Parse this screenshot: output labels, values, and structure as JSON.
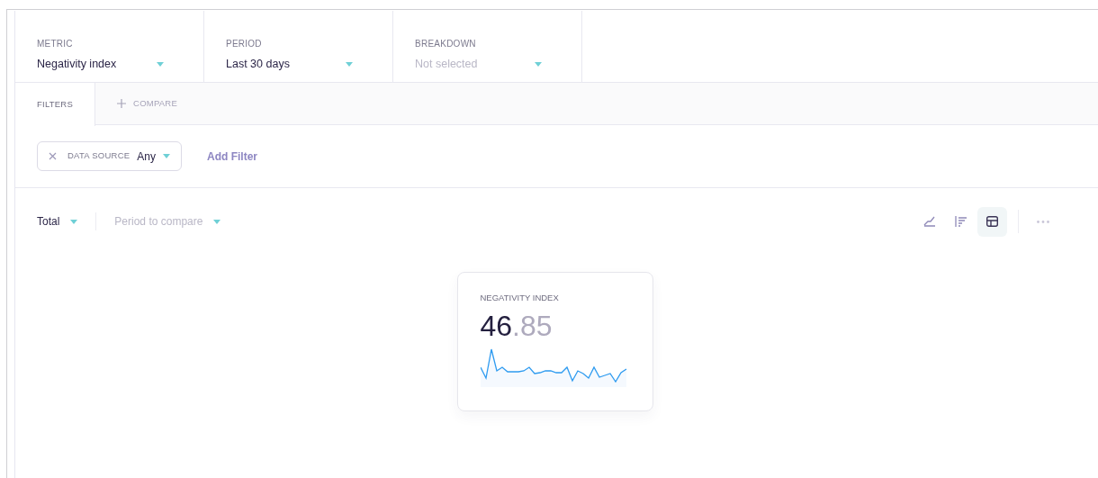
{
  "selectors": [
    {
      "label": "METRIC",
      "value": "Negativity index"
    },
    {
      "label": "PERIOD",
      "value": "Last 30 days"
    },
    {
      "label": "BREAKDOWN",
      "placeholder": "Not selected"
    }
  ],
  "tabs": [
    {
      "label": "FILTERS",
      "selected": true,
      "kind": "plain"
    },
    {
      "label": "COMPARE",
      "selected": false,
      "kind": "add"
    }
  ],
  "filters": [
    {
      "label": "DATA SOURCE",
      "value": "Any"
    }
  ],
  "add_filter": "Add Filter",
  "toolbar": {
    "aggregation": "Total",
    "compare_placeholder": "Period to compare",
    "views": [
      {
        "kind": "line",
        "selected": false
      },
      {
        "kind": "bars",
        "selected": false
      },
      {
        "kind": "table",
        "selected": true
      }
    ]
  },
  "card": {
    "title": "NEGATIVITY INDEX",
    "whole": "46",
    "fraction": ".85"
  }
}
